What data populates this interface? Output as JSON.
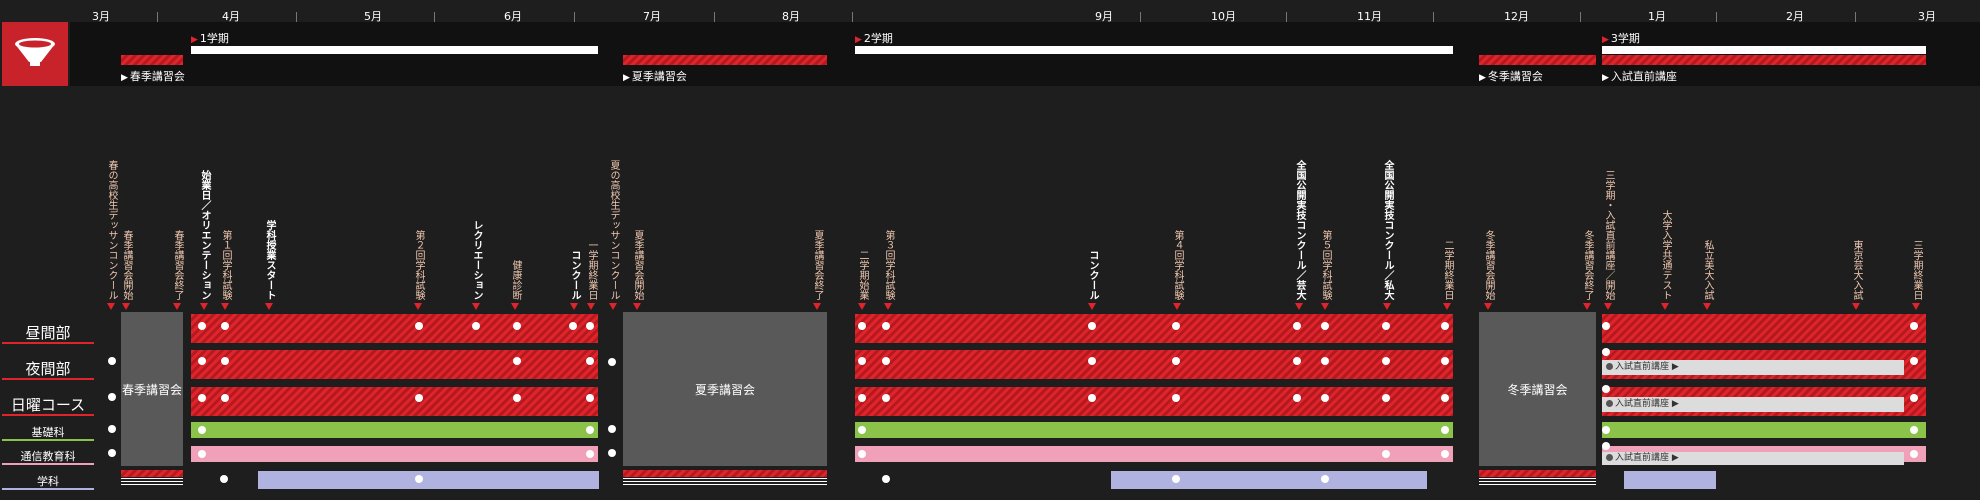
{
  "logo": {
    "icon": "lamp-shade-icon",
    "color": "#c8222a"
  },
  "months": [
    "3月",
    "4月",
    "5月",
    "6月",
    "7月",
    "8月",
    "9月",
    "10月",
    "11月",
    "12月",
    "1月",
    "2月",
    "3月"
  ],
  "terms": {
    "t1": "1学期",
    "t2": "2学期",
    "t3": "3学期"
  },
  "sessions": {
    "spring": "春季講習会",
    "summer": "夏季講習会",
    "winter": "冬季講習会",
    "exam_prep": "入試直前講座"
  },
  "row_labels": {
    "daytime": "昼間部",
    "evening": "夜間部",
    "sunday": "日曜コース",
    "basic": "基礎科",
    "correspondence": "通信教育科",
    "academic": "学科"
  },
  "row_colors": {
    "daytime": "#e0242b",
    "evening": "#e0242b",
    "sunday": "#e0242b",
    "basic": "#8bc34a",
    "correspondence": "#f0a0b8",
    "academic": "#b0b3e0"
  },
  "events": [
    "春の高校生デッサンコンクール",
    "春季講習会開始",
    "春季講習会終了",
    "始業日／オリエンテーション",
    "第１回学科試験",
    "学科授業スタート",
    "第２回学科試験",
    "レクリエーション",
    "健康診断",
    "コンクール",
    "一学期終業日",
    "夏の高校生デッサンコンクール",
    "夏季講習会開始",
    "夏季講習会終了",
    "二学期始業",
    "第３回学科試験",
    "コンクール",
    "第４回学科試験",
    "全国公開実技コンクール／芸大",
    "第５回学科試験",
    "全国公開実技コンクール／私大",
    "二学期終業日",
    "冬季講習会開始",
    "冬季講習会終了",
    "三学期・入試直前講座／開始",
    "大学入学共通テスト",
    "私立美大入試",
    "東京芸大入試",
    "三学期終業日"
  ]
}
